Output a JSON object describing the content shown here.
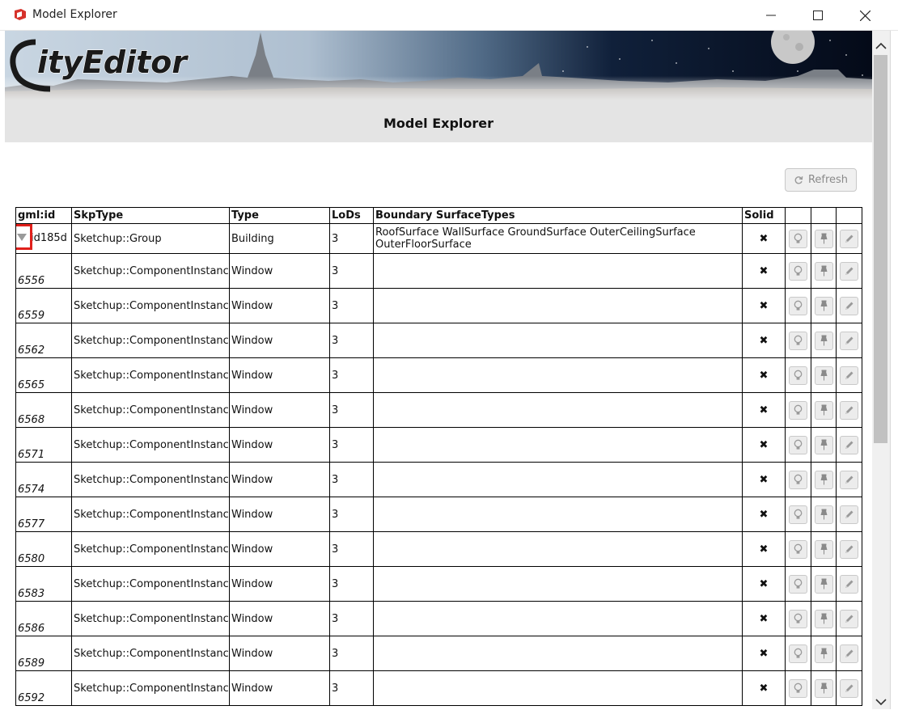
{
  "window": {
    "title": "Model Explorer"
  },
  "header": {
    "logo_text": "CityEditor",
    "page_title": "Model Explorer"
  },
  "toolbar": {
    "refresh_label": "Refresh"
  },
  "table": {
    "columns": [
      "gml:id",
      "SkpType",
      "Type",
      "LoDs",
      "Boundary SurfaceTypes",
      "Solid",
      "",
      "",
      ""
    ],
    "rows": [
      {
        "gml_id": "id185d",
        "skp_type": "Sketchup::Group",
        "type": "Building",
        "lods": "3",
        "boundary": "RoofSurface WallSurface GroundSurface OuterCeilingSurface OuterFloorSurface",
        "solid": "✖"
      },
      {
        "gml_id": "6556",
        "skp_type": "Sketchup::ComponentInstance",
        "type": "Window",
        "lods": "3",
        "boundary": "",
        "solid": "✖"
      },
      {
        "gml_id": "6559",
        "skp_type": "Sketchup::ComponentInstance",
        "type": "Window",
        "lods": "3",
        "boundary": "",
        "solid": "✖"
      },
      {
        "gml_id": "6562",
        "skp_type": "Sketchup::ComponentInstance",
        "type": "Window",
        "lods": "3",
        "boundary": "",
        "solid": "✖"
      },
      {
        "gml_id": "6565",
        "skp_type": "Sketchup::ComponentInstance",
        "type": "Window",
        "lods": "3",
        "boundary": "",
        "solid": "✖"
      },
      {
        "gml_id": "6568",
        "skp_type": "Sketchup::ComponentInstance",
        "type": "Window",
        "lods": "3",
        "boundary": "",
        "solid": "✖"
      },
      {
        "gml_id": "6571",
        "skp_type": "Sketchup::ComponentInstance",
        "type": "Window",
        "lods": "3",
        "boundary": "",
        "solid": "✖"
      },
      {
        "gml_id": "6574",
        "skp_type": "Sketchup::ComponentInstance",
        "type": "Window",
        "lods": "3",
        "boundary": "",
        "solid": "✖"
      },
      {
        "gml_id": "6577",
        "skp_type": "Sketchup::ComponentInstance",
        "type": "Window",
        "lods": "3",
        "boundary": "",
        "solid": "✖"
      },
      {
        "gml_id": "6580",
        "skp_type": "Sketchup::ComponentInstance",
        "type": "Window",
        "lods": "3",
        "boundary": "",
        "solid": "✖"
      },
      {
        "gml_id": "6583",
        "skp_type": "Sketchup::ComponentInstance",
        "type": "Window",
        "lods": "3",
        "boundary": "",
        "solid": "✖"
      },
      {
        "gml_id": "6586",
        "skp_type": "Sketchup::ComponentInstance",
        "type": "Window",
        "lods": "3",
        "boundary": "",
        "solid": "✖"
      },
      {
        "gml_id": "6589",
        "skp_type": "Sketchup::ComponentInstance",
        "type": "Window",
        "lods": "3",
        "boundary": "",
        "solid": "✖"
      },
      {
        "gml_id": "6592",
        "skp_type": "Sketchup::ComponentInstance",
        "type": "Window",
        "lods": "3",
        "boundary": "",
        "solid": "✖"
      }
    ],
    "row_actions": [
      "bulb-icon",
      "pin-icon",
      "pencil-icon"
    ]
  },
  "icons": {
    "app": "sketchup-icon",
    "minimize": "minimize-icon",
    "maximize": "maximize-icon",
    "close": "close-icon",
    "refresh": "refresh-icon",
    "expander": "triangle-down-icon"
  },
  "colors": {
    "header_bar": "#e4e4e4",
    "expander_highlight": "#e0201b",
    "action_icon": "#8a8a8a"
  }
}
